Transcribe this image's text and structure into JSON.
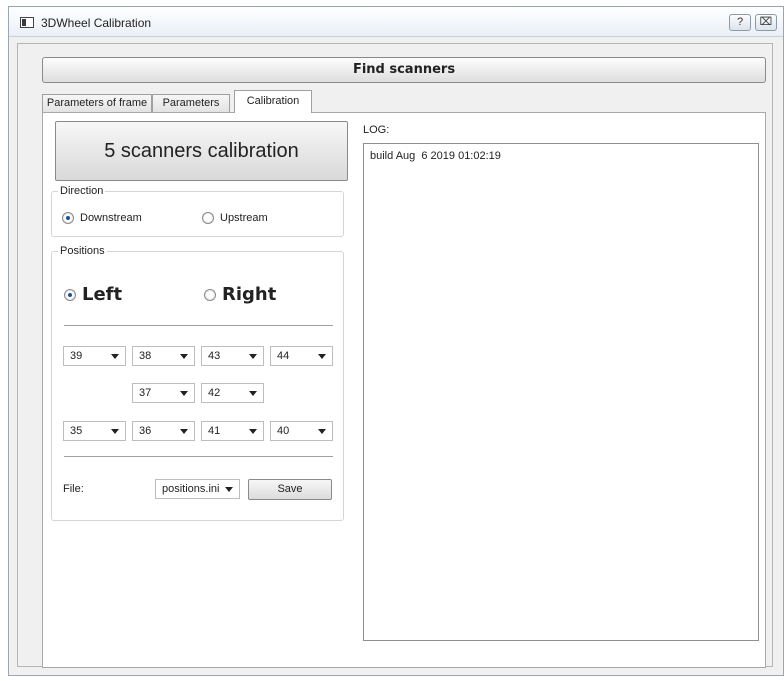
{
  "window": {
    "title": "3DWheel Calibration",
    "help_glyph": "?",
    "close_glyph": "⌧"
  },
  "find_scanners_label": "Find scanners",
  "tabs": [
    {
      "label": "Parameters of frame",
      "active": false
    },
    {
      "label": "Parameters",
      "active": false
    },
    {
      "label": "Calibration",
      "active": true
    }
  ],
  "calibration": {
    "calibrate_button": "5 scanners calibration",
    "direction": {
      "title": "Direction",
      "options": [
        "Downstream",
        "Upstream"
      ],
      "selected": "Downstream"
    },
    "positions": {
      "title": "Positions",
      "side_options": [
        "Left",
        "Right"
      ],
      "selected_side": "Left",
      "row1": [
        "39",
        "38",
        "43",
        "44"
      ],
      "row2": [
        "37",
        "42"
      ],
      "row3": [
        "35",
        "36",
        "41",
        "40"
      ],
      "file_label": "File:",
      "file_value": "positions.ini",
      "save_label": "Save"
    }
  },
  "log": {
    "label": "LOG:",
    "text": "build Aug  6 2019 01:02:19"
  },
  "colors": {
    "radio_selected": "#1d4fa0",
    "panel_bg": "#ffffff",
    "window_bg": "#f0f0f0"
  }
}
